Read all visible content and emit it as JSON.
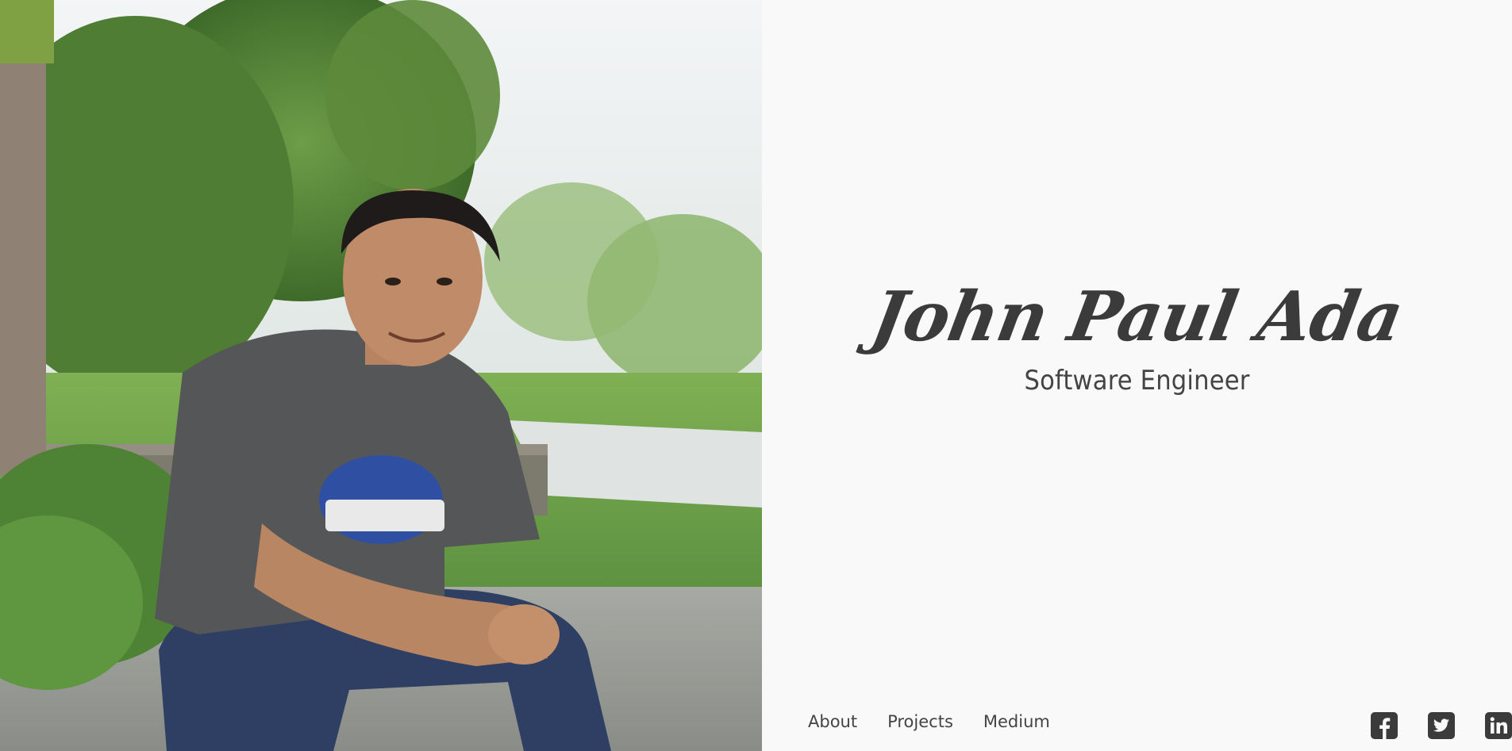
{
  "profile": {
    "name": "John Paul Ada",
    "role": "Software Engineer",
    "photo_alt": "Portrait photo of a smiling young man in a grey t-shirt sitting outdoors among plants"
  },
  "nav": {
    "items": [
      {
        "label": "About"
      },
      {
        "label": "Projects"
      },
      {
        "label": "Medium"
      }
    ]
  },
  "social": {
    "items": [
      {
        "icon": "facebook-icon"
      },
      {
        "icon": "twitter-icon"
      },
      {
        "icon": "linkedin-icon"
      }
    ]
  },
  "colors": {
    "background": "#f9f9f9",
    "text": "#3b3b3b"
  }
}
